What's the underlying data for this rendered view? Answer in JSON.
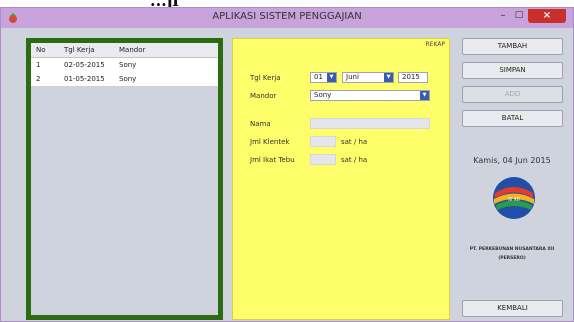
{
  "heading": "...ji",
  "window": {
    "title": "APLIKASI SISTEM PENGGAJIAN",
    "controls": {
      "minimize": "–",
      "maximize": "□",
      "close": "×"
    }
  },
  "table": {
    "headers": [
      "No",
      "Tgl Kerja",
      "Mandor"
    ],
    "rows": [
      {
        "no": "1",
        "tgl": "02-05-2015",
        "mandor": "Sony"
      },
      {
        "no": "2",
        "tgl": "01-05-2015",
        "mandor": "Sony"
      }
    ]
  },
  "form": {
    "corner_label": "REKAP",
    "tgl_label": "Tgl Kerja",
    "day": "01",
    "month": "Juni",
    "year": "2015",
    "mandor_label": "Mandor",
    "mandor_value": "Sony",
    "nama_label": "Nama",
    "nama_value": "",
    "klentek_label": "Jml Klentek",
    "klentek_value": "",
    "klentek_unit": "sat / ha",
    "ikat_label": "Jml Ikat Tebu",
    "ikat_value": "",
    "ikat_unit": "sat / ha",
    "dropdown_arrow": "▼"
  },
  "sidebar": {
    "tambah": "TAMBAH",
    "simpan": "SIMPAN",
    "add": "ADD",
    "batal": "BATAL",
    "date": "Kamis, 04 Jun 2015",
    "company_line1": "PT. PERKEBUNAN NUSANTARA XII",
    "company_line2": "(PERSERO)",
    "kembali": "KEMBALI",
    "logo_text": "N XII"
  },
  "colors": {
    "titlebar": "#c9a3db",
    "form_panel": "#fefe6a",
    "table_border": "#2d6b10",
    "window_bg": "#cfd3de"
  },
  "icons": {
    "app": "app-icon",
    "logo": "ptpn-logo-icon"
  }
}
